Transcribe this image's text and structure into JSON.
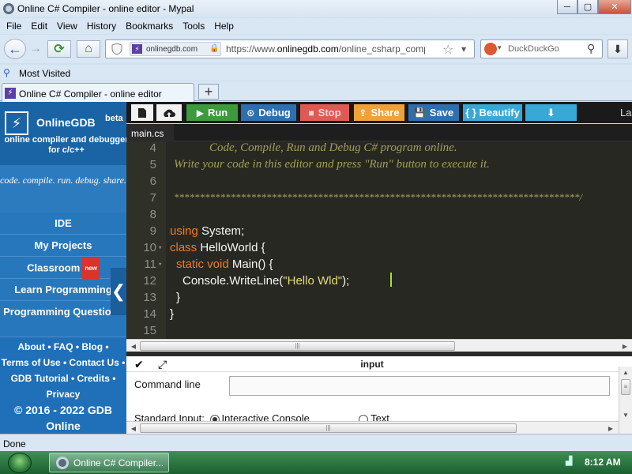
{
  "window": {
    "title": "Online C# Compiler - online editor - Mypal",
    "minimize": "─",
    "maximize": "▢",
    "close": "✕"
  },
  "menu": [
    "File",
    "Edit",
    "View",
    "History",
    "Bookmarks",
    "Tools",
    "Help"
  ],
  "nav": {
    "back": "←",
    "forward": "→",
    "reload": "⟳",
    "home": "⌂",
    "site_chip": "onlinegdb.com",
    "url_prefix": "https://www.",
    "url_domain": "onlinegdb.com",
    "url_path": "/online_csharp_compile",
    "star": "☆",
    "dropdown": "▾",
    "search_placeholder": "DuckDuckGo",
    "download": "⬇"
  },
  "bookmarks": {
    "most_visited": "Most Visited"
  },
  "tab": {
    "title": "Online C# Compiler - online editor",
    "new_tab": "+"
  },
  "sidebar": {
    "brand": "OnlineGDB",
    "beta": "beta",
    "subtitle": "online compiler and debugger for c/c++",
    "tagline": "code. compile. run. debug. share.",
    "items": [
      {
        "label": "IDE"
      },
      {
        "label": "My Projects"
      },
      {
        "label": "Classroom",
        "badge": "new"
      },
      {
        "label": "Learn Programming"
      },
      {
        "label": "Programming Questions"
      }
    ],
    "links_row1": "About • FAQ • Blog •",
    "links_row2": "Terms of Use • Contact Us •",
    "links_row3": "GDB Tutorial • Credits •",
    "links_row4": "Privacy",
    "copyright": "© 2016 - 2022 GDB Online",
    "collapse": "❮"
  },
  "toolbar": {
    "run": "Run",
    "debug": "Debug",
    "stop": "Stop",
    "share": "Share",
    "save": "Save",
    "beautify": "{ } Beautify",
    "language_partial": "La",
    "colors": {
      "run": "#3d9a3d",
      "debug": "#2e6fb0",
      "stop": "#e05a55",
      "share": "#f0a13a",
      "save": "#2e6fb0",
      "beautify": "#38a8d6",
      "download": "#38a8d6"
    }
  },
  "editor": {
    "file_tab": "main.cs",
    "lines": [
      {
        "n": "4",
        "text": "            Code, Compile, Run and Debug C# program online."
      },
      {
        "n": "5",
        "text": "Write your code in this editor and press \"Run\" button to execute it."
      },
      {
        "n": "6",
        "text": ""
      },
      {
        "n": "7",
        "text": "*******************************************************************************/"
      },
      {
        "n": "8",
        "text": ""
      },
      {
        "n": "9",
        "using": "using",
        "rest": " System;"
      },
      {
        "n": "10",
        "kw": "class",
        "rest": " HelloWorld {"
      },
      {
        "n": "11",
        "kw": "static void",
        "rest": " Main() {"
      },
      {
        "n": "12",
        "pre": "Console.WriteLine(",
        "str": "\"Hello Wld\"",
        "post": ");"
      },
      {
        "n": "13",
        "text": "}"
      },
      {
        "n": "14",
        "text": "}"
      },
      {
        "n": "15",
        "text": ""
      }
    ]
  },
  "io": {
    "title": "input",
    "command_line_label": "Command line",
    "stdin_label": "Standard Input:",
    "interactive": "Interactive Console",
    "text": "Text"
  },
  "status": {
    "text": "Done"
  },
  "taskbar": {
    "item": "Online C# Compiler...",
    "clock": "8:12 AM"
  }
}
